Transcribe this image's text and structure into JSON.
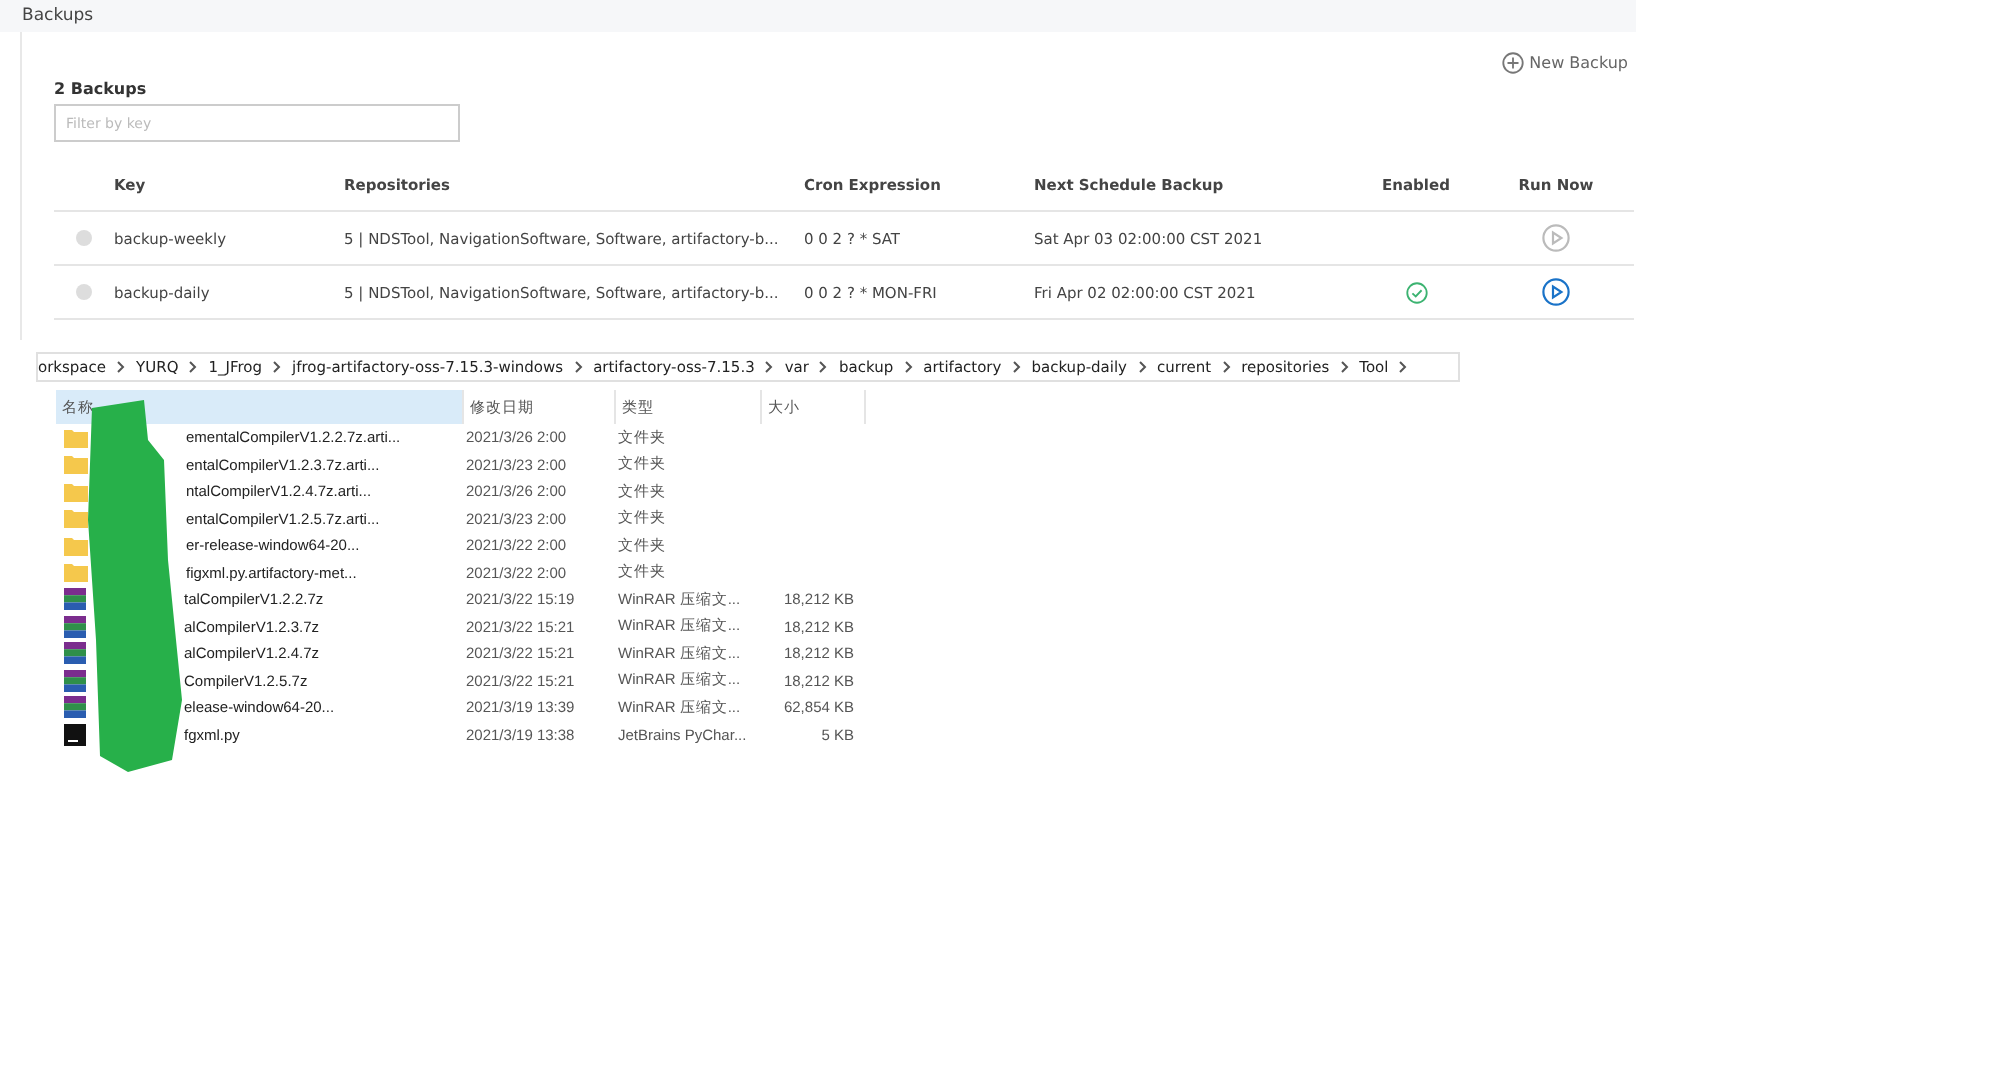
{
  "page": {
    "title": "Backups"
  },
  "backups": {
    "count_label": "2 Backups",
    "new_button": "New Backup",
    "filter": {
      "placeholder": "Filter by key"
    },
    "columns": [
      "Key",
      "Repositories",
      "Cron Expression",
      "Next Schedule Backup",
      "Enabled",
      "Run Now"
    ],
    "rows": [
      {
        "key": "backup-weekly",
        "repositories": "5 | NDSTool, NavigationSoftware, Software, artifactory-b...",
        "cron": "0 0 2 ? * SAT",
        "next": "Sat Apr 03 02:00:00 CST 2021",
        "enabled": false
      },
      {
        "key": "backup-daily",
        "repositories": "5 | NDSTool, NavigationSoftware, Software, artifactory-b...",
        "cron": "0 0 2 ? * MON-FRI",
        "next": "Fri Apr 02 02:00:00 CST 2021",
        "enabled": true
      }
    ]
  },
  "explorer": {
    "breadcrumb": [
      "orkspace",
      "YURQ",
      "1_JFrog",
      "jfrog-artifactory-oss-7.15.3-windows",
      "artifactory-oss-7.15.3",
      "var",
      "backup",
      "artifactory",
      "backup-daily",
      "current",
      "repositories",
      "Tool"
    ],
    "columns": [
      {
        "label": "名称",
        "selected": true
      },
      {
        "label": "修改日期",
        "selected": false
      },
      {
        "label": "类型",
        "selected": false
      },
      {
        "label": "大小",
        "selected": false
      }
    ],
    "files": [
      {
        "kind": "folder",
        "name": "ementalCompilerV1.2.2.7z.arti...",
        "date": "2021/3/26 2:00",
        "type": "文件夹"
      },
      {
        "kind": "folder",
        "name": "entalCompilerV1.2.3.7z.arti...",
        "date": "2021/3/23 2:00",
        "type": "文件夹"
      },
      {
        "kind": "folder",
        "name": "ntalCompilerV1.2.4.7z.arti...",
        "date": "2021/3/26 2:00",
        "type": "文件夹"
      },
      {
        "kind": "folder",
        "name": "entalCompilerV1.2.5.7z.arti...",
        "date": "2021/3/23 2:00",
        "type": "文件夹"
      },
      {
        "kind": "folder",
        "name": "er-release-window64-20...",
        "date": "2021/3/22 2:00",
        "type": "文件夹"
      },
      {
        "kind": "folder",
        "name": "figxml.py.artifactory-met...",
        "date": "2021/3/22 2:00",
        "type": "文件夹"
      },
      {
        "kind": "archive",
        "name": "talCompilerV1.2.2.7z",
        "date": "2021/3/22 15:19",
        "type": "WinRAR 压缩文...",
        "size": "18,212 KB"
      },
      {
        "kind": "archive",
        "name": "alCompilerV1.2.3.7z",
        "date": "2021/3/22 15:21",
        "type": "WinRAR 压缩文...",
        "size": "18,212 KB"
      },
      {
        "kind": "archive",
        "name": "alCompilerV1.2.4.7z",
        "date": "2021/3/22 15:21",
        "type": "WinRAR 压缩文...",
        "size": "18,212 KB"
      },
      {
        "kind": "archive",
        "name": "CompilerV1.2.5.7z",
        "date": "2021/3/22 15:21",
        "type": "WinRAR 压缩文...",
        "size": "18,212 KB"
      },
      {
        "kind": "archive",
        "name": "elease-window64-20...",
        "date": "2021/3/19 13:39",
        "type": "WinRAR 压缩文...",
        "size": "62,854 KB"
      },
      {
        "kind": "python",
        "name": "fgxml.py",
        "date": "2021/3/19 13:38",
        "type": "JetBrains PyChar...",
        "size": "5 KB"
      }
    ]
  }
}
